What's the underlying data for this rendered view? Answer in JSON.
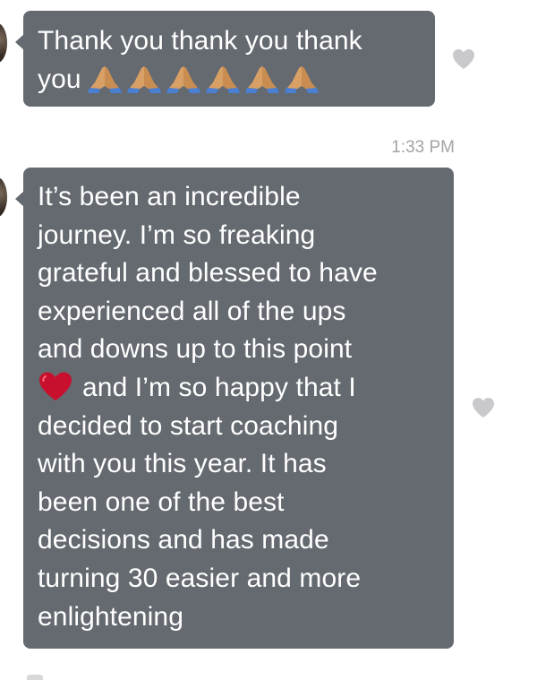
{
  "messages": [
    {
      "text": "Thank you thank you thank\nyou",
      "emoji_after": [
        "folded-hands",
        "folded-hands",
        "folded-hands",
        "folded-hands",
        "folded-hands",
        "folded-hands"
      ],
      "liked": false
    },
    {
      "text_before_emoji": "It’s been an incredible\njourney. I’m so freaking\ngrateful and blessed to have\nexperienced all of the ups\nand downs up to this point\n",
      "inline_emoji": "red-heart",
      "text_after_emoji": "and I’m so happy that I\ndecided to start coaching\nwith you this year. It has\nbeen one of the best\ndecisions and has made\nturning 30 easier and more\nenlightening",
      "liked": false
    }
  ],
  "timestamp": "1:33 PM",
  "colors": {
    "bubble": "#656a70",
    "text": "#ffffff",
    "timestamp": "#a4a4a8",
    "like_heart": "#c9c9cc",
    "inline_heart": "#c8102e"
  },
  "icons": {
    "like": "heart-icon",
    "pray": "folded-hands-emoji",
    "heart": "red-heart-emoji"
  }
}
